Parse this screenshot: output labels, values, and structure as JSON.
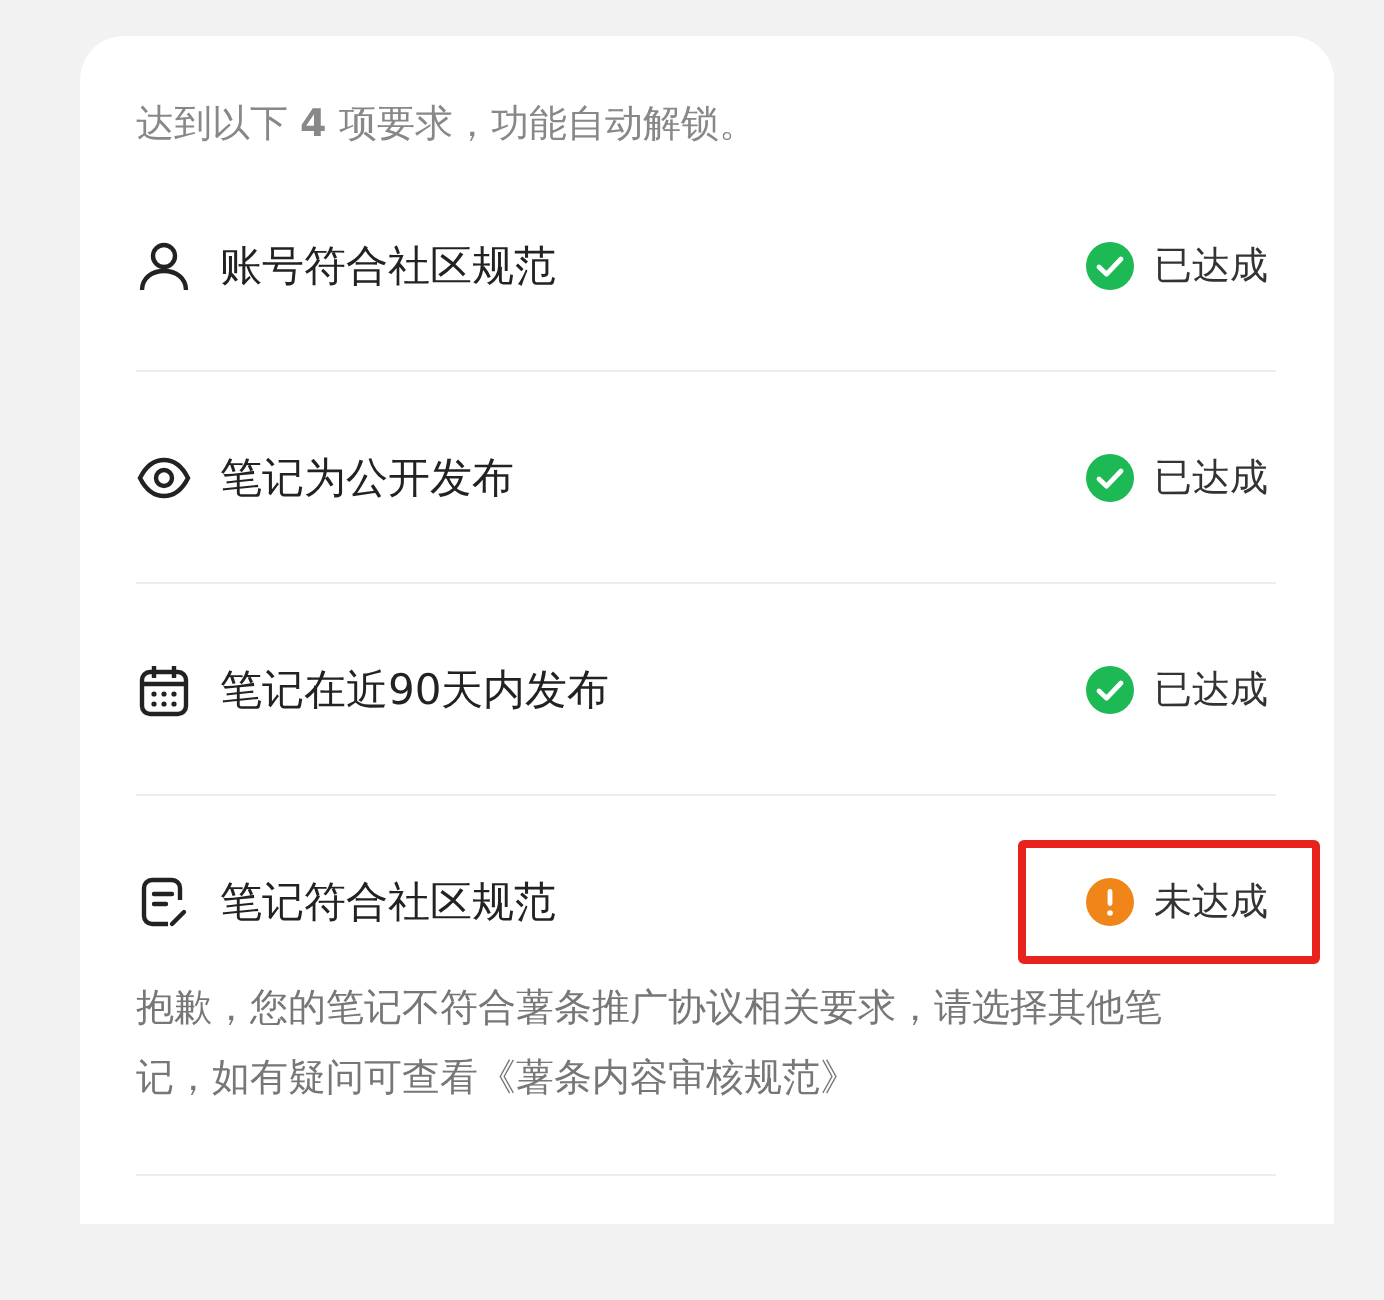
{
  "intro": "达到以下 **4** 项要求，功能自动解锁。",
  "requirements": [
    {
      "kind": "person",
      "label": "账号符合社区规范",
      "status": "已达成",
      "met": true,
      "highlighted": false
    },
    {
      "kind": "eye",
      "label": "笔记为公开发布",
      "status": "已达成",
      "met": true,
      "highlighted": false
    },
    {
      "kind": "calendar",
      "label": "笔记在近90天内发布",
      "status": "已达成",
      "met": true,
      "highlighted": false
    },
    {
      "kind": "note",
      "label": "笔记符合社区规范",
      "status": "未达成",
      "met": false,
      "highlighted": true,
      "note": "抱歉，您的笔记不符合薯条推广协议相关要求，请选择其他笔记，如有疑问可查看《薯条内容审核规范》"
    }
  ]
}
